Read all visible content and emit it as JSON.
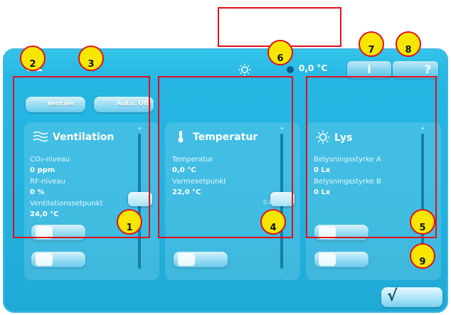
{
  "header": {
    "title": "e 1",
    "temperature": "0,0 °C",
    "info_label": "i",
    "help_label": "?"
  },
  "buttons": {
    "ventiler": "Ventilér",
    "auto_off": "Auto. Off"
  },
  "cards": {
    "ventilation": {
      "title": "Ventilation",
      "co2_label": "CO₂-niveau",
      "co2_value": "0 ppm",
      "rf_label": "RF-niveau",
      "rf_value": "0 %",
      "setpoint_label": "Ventilationssetpunkt",
      "setpoint_value": "24,0 °C",
      "slider_top": "+",
      "slider_bottom": "-"
    },
    "temperatur": {
      "title": "Temperatur",
      "temp_label": "Temperatur",
      "temp_value": "0,0 °C",
      "heat_label": "Varmesetpunkt",
      "heat_value": "22,0 °C",
      "slider_mark": "0,0",
      "slider_top": "+",
      "slider_bottom": "-"
    },
    "lys": {
      "title": "Lys",
      "a_label": "Belysningsstyrke A",
      "a_value": "0 Lx",
      "b_label": "Belysningsstyrke B",
      "b_value": "0 Lx",
      "slider_top": "+",
      "slider_bottom": "-"
    }
  },
  "badges": [
    "2",
    "3",
    "6",
    "7",
    "8",
    "1",
    "4",
    "5",
    "9"
  ],
  "ok_label": "√",
  "colors": {
    "panel": "#22b2de",
    "badge": "#f7e600",
    "callout": "#e0101a"
  }
}
